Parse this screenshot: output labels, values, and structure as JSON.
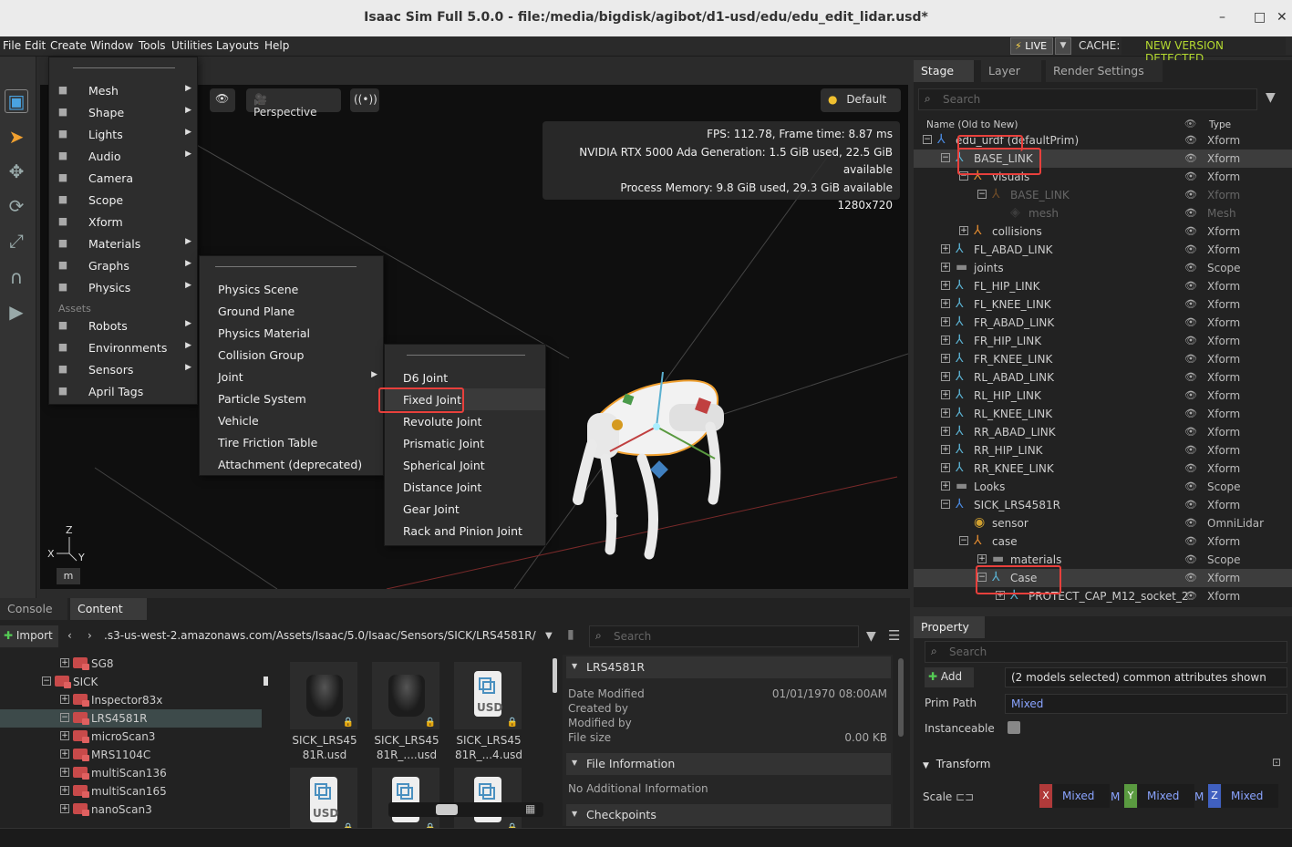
{
  "window": {
    "title": "Isaac Sim Full 5.0.0 - file:/media/bigdisk/agibot/d1-usd/edu/edu_edit_lidar.usd*",
    "minimize": "–",
    "maximize": "□",
    "close": "✕"
  },
  "menubar": {
    "items": [
      "File",
      "Edit",
      "Create",
      "Window",
      "Tools",
      "Utilities",
      "Layouts",
      "Help"
    ],
    "live": "LIVE",
    "cache": "CACHE:",
    "new_version": "NEW VERSION DETECTED"
  },
  "viewport": {
    "camera": "Perspective",
    "render_mode": "Default",
    "stats": [
      "FPS: 112.78, Frame time: 8.87 ms",
      "NVIDIA RTX 5000 Ada Generation: 1.5 GiB used, 22.5 GiB available",
      "Process Memory: 9.8 GiB used, 29.3 GiB available",
      "1280x720"
    ],
    "axis_z": "Z",
    "axis_x": "X",
    "axis_y": "Y",
    "m_key": "m"
  },
  "create_menu": {
    "items": [
      {
        "label": "Mesh",
        "icon": "mesh-icon",
        "sub": true
      },
      {
        "label": "Shape",
        "icon": "shape-icon",
        "sub": true
      },
      {
        "label": "Lights",
        "icon": "light-icon",
        "sub": true
      },
      {
        "label": "Audio",
        "icon": "audio-icon",
        "sub": true
      },
      {
        "label": "Camera",
        "icon": "camera-icon",
        "sub": false
      },
      {
        "label": "Scope",
        "icon": "folder-icon",
        "sub": false
      },
      {
        "label": "Xform",
        "icon": "xform-icon",
        "sub": false
      },
      {
        "label": "Materials",
        "icon": "material-icon",
        "sub": true
      },
      {
        "label": "Graphs",
        "icon": "graph-icon",
        "sub": true
      },
      {
        "label": "Physics",
        "icon": "physics-icon",
        "sub": true
      }
    ],
    "assets_label": "Assets",
    "asset_items": [
      {
        "label": "Robots",
        "icon": "robot-icon",
        "sub": true
      },
      {
        "label": "Environments",
        "icon": "globe-icon",
        "sub": true
      },
      {
        "label": "Sensors",
        "icon": "sensor-icon",
        "sub": true
      },
      {
        "label": "April Tags",
        "icon": "apriltag-icon",
        "sub": false
      }
    ],
    "arrow": "▶"
  },
  "physics_menu": {
    "items": [
      {
        "label": "Physics Scene",
        "sub": false
      },
      {
        "label": "Ground Plane",
        "sub": false
      },
      {
        "label": "Physics Material",
        "sub": false
      },
      {
        "label": "Collision Group",
        "sub": false
      },
      {
        "label": "Joint",
        "sub": true
      },
      {
        "label": "Particle System",
        "sub": false
      },
      {
        "label": "Vehicle",
        "sub": false
      },
      {
        "label": "Tire Friction Table",
        "sub": false
      },
      {
        "label": "Attachment (deprecated)",
        "sub": false
      }
    ]
  },
  "joint_menu": {
    "items": [
      "D6 Joint",
      "Fixed Joint",
      "Revolute Joint",
      "Prismatic Joint",
      "Spherical Joint",
      "Distance Joint",
      "Gear Joint",
      "Rack and Pinion Joint"
    ]
  },
  "stage": {
    "tabs": [
      "Stage",
      "Layer",
      "Render Settings"
    ],
    "search_placeholder": "Search",
    "col_name": "Name (Old to New)",
    "col_type": "Type",
    "rows": [
      {
        "name": "edu_urdf (defaultPrim)",
        "type": "Xform",
        "indent": 0,
        "exp": "−",
        "icon": "xform-blue",
        "sel": false,
        "dim": false
      },
      {
        "name": "BASE_LINK",
        "type": "Xform",
        "indent": 1,
        "exp": "−",
        "icon": "xform",
        "sel": true,
        "dim": false
      },
      {
        "name": "visuals",
        "type": "Xform",
        "indent": 2,
        "exp": "−",
        "icon": "xform-orange",
        "sel": false,
        "dim": false
      },
      {
        "name": "BASE_LINK",
        "type": "Xform",
        "indent": 3,
        "exp": "−",
        "icon": "xform-orange",
        "sel": false,
        "dim": true
      },
      {
        "name": "mesh",
        "type": "Mesh",
        "indent": 4,
        "exp": "",
        "icon": "mesh",
        "sel": false,
        "dim": true
      },
      {
        "name": "collisions",
        "type": "Xform",
        "indent": 2,
        "exp": "+",
        "icon": "xform-orange",
        "sel": false,
        "dim": false
      },
      {
        "name": "FL_ABAD_LINK",
        "type": "Xform",
        "indent": 1,
        "exp": "+",
        "icon": "xform",
        "sel": false,
        "dim": false
      },
      {
        "name": "joints",
        "type": "Scope",
        "indent": 1,
        "exp": "+",
        "icon": "folder",
        "sel": false,
        "dim": false
      },
      {
        "name": "FL_HIP_LINK",
        "type": "Xform",
        "indent": 1,
        "exp": "+",
        "icon": "xform",
        "sel": false,
        "dim": false
      },
      {
        "name": "FL_KNEE_LINK",
        "type": "Xform",
        "indent": 1,
        "exp": "+",
        "icon": "xform",
        "sel": false,
        "dim": false
      },
      {
        "name": "FR_ABAD_LINK",
        "type": "Xform",
        "indent": 1,
        "exp": "+",
        "icon": "xform",
        "sel": false,
        "dim": false
      },
      {
        "name": "FR_HIP_LINK",
        "type": "Xform",
        "indent": 1,
        "exp": "+",
        "icon": "xform",
        "sel": false,
        "dim": false
      },
      {
        "name": "FR_KNEE_LINK",
        "type": "Xform",
        "indent": 1,
        "exp": "+",
        "icon": "xform",
        "sel": false,
        "dim": false
      },
      {
        "name": "RL_ABAD_LINK",
        "type": "Xform",
        "indent": 1,
        "exp": "+",
        "icon": "xform",
        "sel": false,
        "dim": false
      },
      {
        "name": "RL_HIP_LINK",
        "type": "Xform",
        "indent": 1,
        "exp": "+",
        "icon": "xform",
        "sel": false,
        "dim": false
      },
      {
        "name": "RL_KNEE_LINK",
        "type": "Xform",
        "indent": 1,
        "exp": "+",
        "icon": "xform",
        "sel": false,
        "dim": false
      },
      {
        "name": "RR_ABAD_LINK",
        "type": "Xform",
        "indent": 1,
        "exp": "+",
        "icon": "xform",
        "sel": false,
        "dim": false
      },
      {
        "name": "RR_HIP_LINK",
        "type": "Xform",
        "indent": 1,
        "exp": "+",
        "icon": "xform",
        "sel": false,
        "dim": false
      },
      {
        "name": "RR_KNEE_LINK",
        "type": "Xform",
        "indent": 1,
        "exp": "+",
        "icon": "xform",
        "sel": false,
        "dim": false
      },
      {
        "name": "Looks",
        "type": "Scope",
        "indent": 1,
        "exp": "+",
        "icon": "folder",
        "sel": false,
        "dim": false
      },
      {
        "name": "SICK_LRS4581R",
        "type": "Xform",
        "indent": 1,
        "exp": "−",
        "icon": "xform-blue",
        "sel": false,
        "dim": false
      },
      {
        "name": "sensor",
        "type": "OmniLidar",
        "indent": 2,
        "exp": "",
        "icon": "lidar",
        "sel": false,
        "dim": false
      },
      {
        "name": "case",
        "type": "Xform",
        "indent": 2,
        "exp": "−",
        "icon": "xform-orange",
        "sel": false,
        "dim": false
      },
      {
        "name": "materials",
        "type": "Scope",
        "indent": 3,
        "exp": "+",
        "icon": "folder",
        "sel": false,
        "dim": false
      },
      {
        "name": "Case",
        "type": "Xform",
        "indent": 3,
        "exp": "−",
        "icon": "xform",
        "sel": true,
        "dim": false
      },
      {
        "name": "PROTECT_CAP_M12_socket_2",
        "type": "Xform",
        "indent": 4,
        "exp": "+",
        "icon": "xform",
        "sel": false,
        "dim": false
      }
    ]
  },
  "bottom": {
    "tabs": [
      "Console",
      "Content"
    ],
    "import": "Import",
    "path": ".s3-us-west-2.amazonaws.com/Assets/Isaac/5.0/Isaac/Sensors/SICK/LRS4581R/",
    "search_placeholder": "Search",
    "tree": [
      {
        "label": "SG8",
        "indent": 0,
        "exp": "+",
        "sel": false
      },
      {
        "label": "SICK",
        "indent": -1,
        "exp": "−",
        "sel": false
      },
      {
        "label": "Inspector83x",
        "indent": 0,
        "exp": "+",
        "sel": false
      },
      {
        "label": "LRS4581R",
        "indent": 0,
        "exp": "−",
        "sel": true
      },
      {
        "label": "microScan3",
        "indent": 0,
        "exp": "+",
        "sel": false
      },
      {
        "label": "MRS1104C",
        "indent": 0,
        "exp": "+",
        "sel": false
      },
      {
        "label": "multiScan136",
        "indent": 0,
        "exp": "+",
        "sel": false
      },
      {
        "label": "multiScan165",
        "indent": 0,
        "exp": "+",
        "sel": false
      },
      {
        "label": "nanoScan3",
        "indent": 0,
        "exp": "+",
        "sel": false
      }
    ],
    "thumbs": [
      {
        "cap1": "SICK_LRS45",
        "cap2": "81R.usd",
        "kind": "puck"
      },
      {
        "cap1": "SICK_LRS45",
        "cap2": "81R_....usd",
        "kind": "puck"
      },
      {
        "cap1": "SICK_LRS45",
        "cap2": "81R_...4.usd",
        "kind": "usd"
      },
      {
        "cap1": "",
        "cap2": "",
        "kind": "usd"
      },
      {
        "cap1": "",
        "cap2": "",
        "kind": "usd"
      },
      {
        "cap1": "",
        "cap2": "",
        "kind": "usd"
      }
    ],
    "usd_text": "USD",
    "info": {
      "title": "LRS4581R",
      "date_modified_label": "Date Modified",
      "date_modified": "01/01/1970 08:00AM",
      "created_by_label": "Created by",
      "modified_by_label": "Modified by",
      "file_size_label": "File size",
      "file_size": "0.00 KB",
      "file_info": "File Information",
      "no_info": "No Additional Information",
      "checkpoints": "Checkpoints"
    }
  },
  "property": {
    "tab": "Property",
    "search_placeholder": "Search",
    "add": "Add",
    "models_selected": "(2 models selected) common attributes shown",
    "prim_path_label": "Prim Path",
    "prim_path": "Mixed",
    "instanceable_label": "Instanceable",
    "transform": "Transform",
    "scale_label": "Scale",
    "scale": [
      "Mixed",
      "Mixed",
      "Mixed"
    ],
    "axes": [
      "X",
      "Y",
      "Z"
    ],
    "m": "M"
  },
  "colors": {
    "accent_red": "#e8403c",
    "axis_x": "#c04040",
    "axis_y": "#5a9a40",
    "axis_z": "#4060c0",
    "mixed": "#8aa4ff"
  }
}
